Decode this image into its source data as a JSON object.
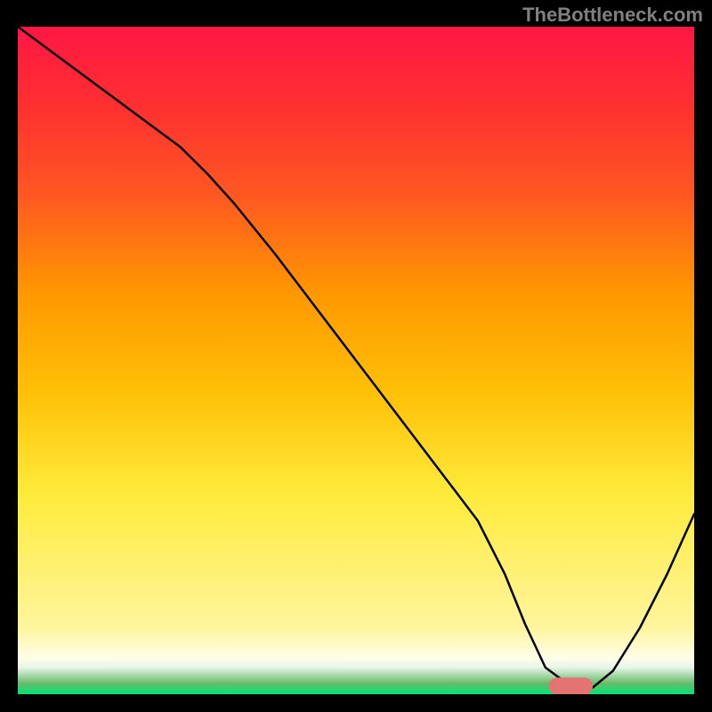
{
  "watermark": "TheBottleneck.com",
  "chart_data": {
    "type": "line",
    "title": "",
    "xlabel": "",
    "ylabel": "",
    "xlim": [
      0,
      100
    ],
    "ylim": [
      0,
      100
    ],
    "background": {
      "type": "vertical_gradient",
      "stops": [
        {
          "offset": 0.0,
          "color": "#ff1744"
        },
        {
          "offset": 0.12,
          "color": "#ff3030"
        },
        {
          "offset": 0.25,
          "color": "#ff5722"
        },
        {
          "offset": 0.4,
          "color": "#ff9800"
        },
        {
          "offset": 0.55,
          "color": "#ffc107"
        },
        {
          "offset": 0.7,
          "color": "#ffeb3b"
        },
        {
          "offset": 0.82,
          "color": "#fff176"
        },
        {
          "offset": 0.9,
          "color": "#fff59d"
        },
        {
          "offset": 0.945,
          "color": "#fffde7"
        },
        {
          "offset": 0.96,
          "color": "#e8f5e9"
        },
        {
          "offset": 0.972,
          "color": "#a5d6a7"
        },
        {
          "offset": 0.984,
          "color": "#66bb6a"
        },
        {
          "offset": 1.0,
          "color": "#00e676"
        }
      ]
    },
    "series": [
      {
        "name": "bottleneck-curve",
        "color": "#000000",
        "stroke_width": 2.5,
        "x": [
          0.0,
          6.0,
          12.0,
          18.0,
          24.0,
          28.0,
          32.0,
          38.0,
          44.0,
          50.0,
          56.0,
          62.0,
          68.0,
          72.0,
          75.0,
          78.0,
          82.0,
          85.0,
          88.0,
          92.0,
          96.0,
          100.0
        ],
        "y": [
          100.0,
          95.5,
          91.0,
          86.5,
          82.0,
          78.0,
          73.5,
          66.0,
          58.0,
          50.0,
          42.0,
          34.0,
          26.0,
          18.0,
          10.5,
          4.0,
          1.0,
          1.0,
          3.5,
          10.0,
          18.0,
          27.0
        ]
      }
    ],
    "marker": {
      "name": "optimal-range",
      "shape": "rounded-rect",
      "color": "#e57373",
      "x_start": 78.5,
      "x_end": 85.0,
      "y": 1.2,
      "height": 2.6
    }
  }
}
